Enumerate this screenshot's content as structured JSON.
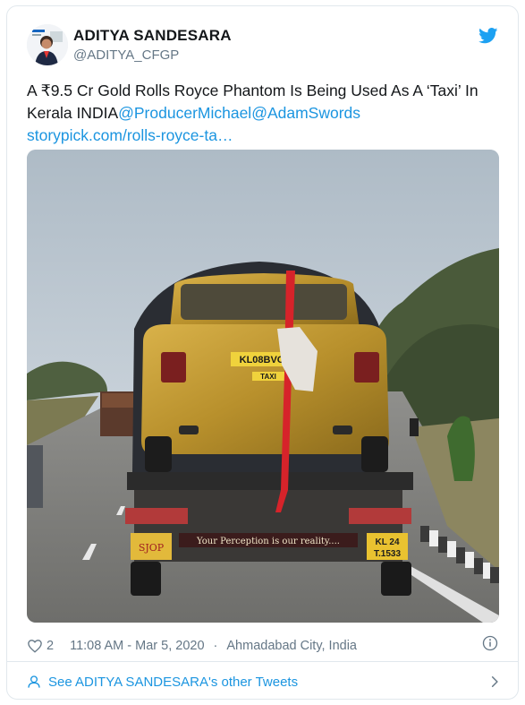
{
  "tweet": {
    "author_name": "ADITYA SANDESARA",
    "author_handle": "@ADITYA_CFGP",
    "text_main": "A ₹9.5 Cr Gold Rolls Royce Phantom Is Being Used As A ‘Taxi’ In Kerala  INDIA",
    "mention_1": "@ProducerMichael",
    "mention_2": "@AdamSwords",
    "link": "storypick.com/rolls-royce-ta…",
    "likes": "2",
    "time": "11:08 AM - Mar 5, 2020",
    "separator": "·",
    "location": "Ahmadabad City, India",
    "more_tweets": "See ADITYA SANDESARA's other Tweets"
  },
  "photo": {
    "plate": "KL08BVO",
    "taxi_label": "TAXI",
    "truck_plate_line1": "KL 24",
    "truck_plate_line2": "T.1533",
    "truck_banner": "Your Perception is our reality....",
    "truck_logo": "SJOP"
  },
  "colors": {
    "link": "#1b95e0",
    "meta": "#657786",
    "twitter_blue": "#1da1f2"
  },
  "icons": {
    "bird": "twitter-bird-icon",
    "heart": "heart-icon",
    "info": "info-icon",
    "person": "person-icon",
    "chevron": "chevron-right-icon"
  }
}
